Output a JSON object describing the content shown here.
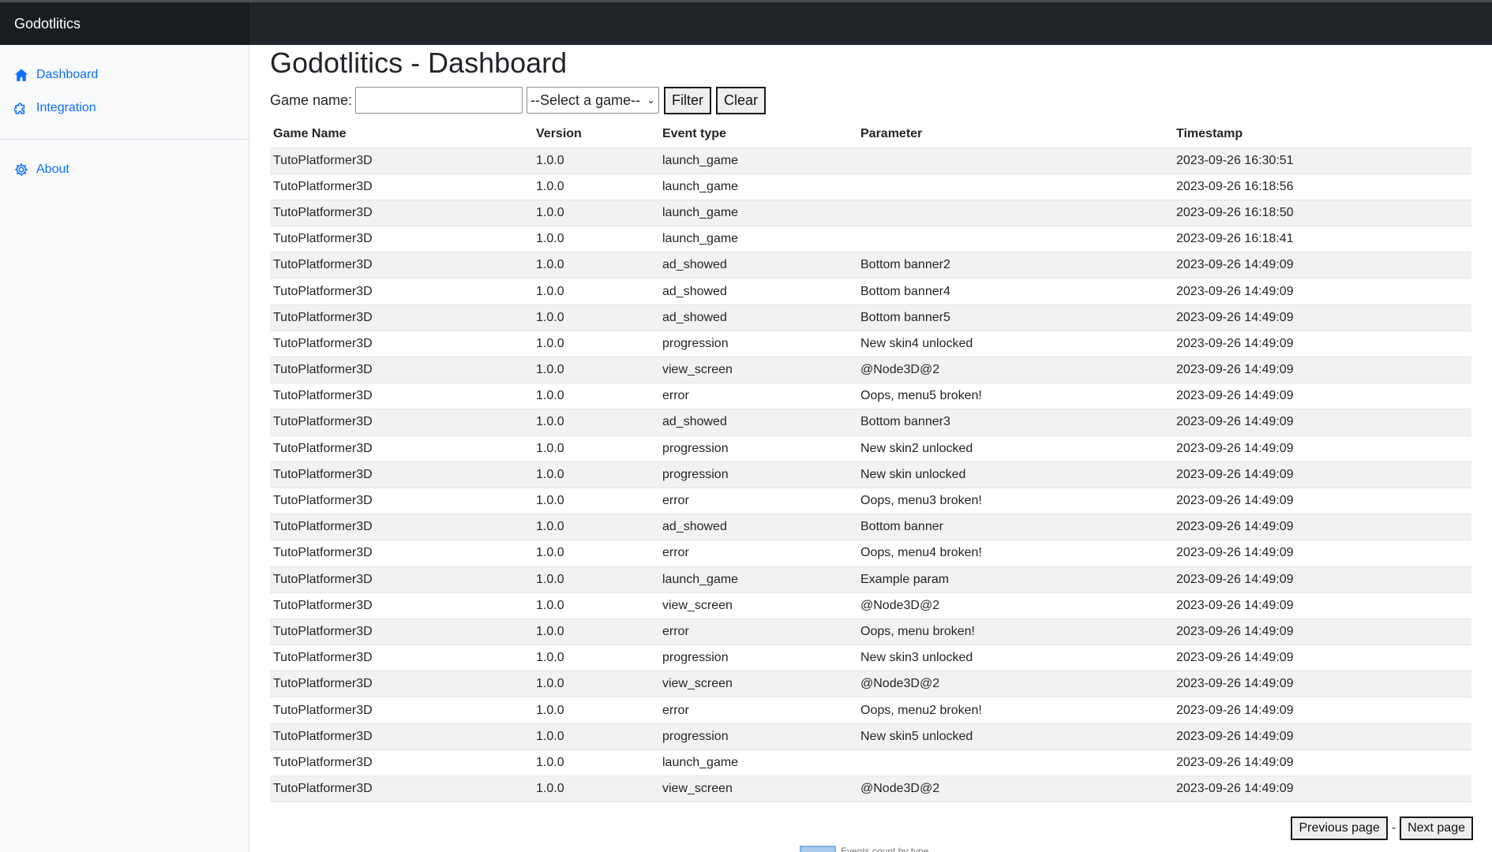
{
  "app": {
    "brand": "Godotlitics"
  },
  "sidebar": {
    "items": [
      {
        "label": "Dashboard",
        "icon": "home-icon"
      },
      {
        "label": "Integration",
        "icon": "puzzle-icon"
      },
      {
        "label": "About",
        "icon": "gear-icon"
      }
    ]
  },
  "page": {
    "title": "Godotlitics - Dashboard"
  },
  "filter": {
    "label": "Game name:",
    "input_value": "",
    "select_value": "--Select a game--",
    "filter_label": "Filter",
    "clear_label": "Clear"
  },
  "table": {
    "headers": [
      "Game Name",
      "Version",
      "Event type",
      "Parameter",
      "Timestamp"
    ],
    "rows": [
      [
        "TutoPlatformer3D",
        "1.0.0",
        "launch_game",
        "",
        "2023-09-26 16:30:51"
      ],
      [
        "TutoPlatformer3D",
        "1.0.0",
        "launch_game",
        "",
        "2023-09-26 16:18:56"
      ],
      [
        "TutoPlatformer3D",
        "1.0.0",
        "launch_game",
        "",
        "2023-09-26 16:18:50"
      ],
      [
        "TutoPlatformer3D",
        "1.0.0",
        "launch_game",
        "",
        "2023-09-26 16:18:41"
      ],
      [
        "TutoPlatformer3D",
        "1.0.0",
        "ad_showed",
        "Bottom banner2",
        "2023-09-26 14:49:09"
      ],
      [
        "TutoPlatformer3D",
        "1.0.0",
        "ad_showed",
        "Bottom banner4",
        "2023-09-26 14:49:09"
      ],
      [
        "TutoPlatformer3D",
        "1.0.0",
        "ad_showed",
        "Bottom banner5",
        "2023-09-26 14:49:09"
      ],
      [
        "TutoPlatformer3D",
        "1.0.0",
        "progression",
        "New skin4 unlocked",
        "2023-09-26 14:49:09"
      ],
      [
        "TutoPlatformer3D",
        "1.0.0",
        "view_screen",
        "@Node3D@2",
        "2023-09-26 14:49:09"
      ],
      [
        "TutoPlatformer3D",
        "1.0.0",
        "error",
        "Oops, menu5 broken!",
        "2023-09-26 14:49:09"
      ],
      [
        "TutoPlatformer3D",
        "1.0.0",
        "ad_showed",
        "Bottom banner3",
        "2023-09-26 14:49:09"
      ],
      [
        "TutoPlatformer3D",
        "1.0.0",
        "progression",
        "New skin2 unlocked",
        "2023-09-26 14:49:09"
      ],
      [
        "TutoPlatformer3D",
        "1.0.0",
        "progression",
        "New skin unlocked",
        "2023-09-26 14:49:09"
      ],
      [
        "TutoPlatformer3D",
        "1.0.0",
        "error",
        "Oops, menu3 broken!",
        "2023-09-26 14:49:09"
      ],
      [
        "TutoPlatformer3D",
        "1.0.0",
        "ad_showed",
        "Bottom banner",
        "2023-09-26 14:49:09"
      ],
      [
        "TutoPlatformer3D",
        "1.0.0",
        "error",
        "Oops, menu4 broken!",
        "2023-09-26 14:49:09"
      ],
      [
        "TutoPlatformer3D",
        "1.0.0",
        "launch_game",
        "Example param",
        "2023-09-26 14:49:09"
      ],
      [
        "TutoPlatformer3D",
        "1.0.0",
        "view_screen",
        "@Node3D@2",
        "2023-09-26 14:49:09"
      ],
      [
        "TutoPlatformer3D",
        "1.0.0",
        "error",
        "Oops, menu broken!",
        "2023-09-26 14:49:09"
      ],
      [
        "TutoPlatformer3D",
        "1.0.0",
        "progression",
        "New skin3 unlocked",
        "2023-09-26 14:49:09"
      ],
      [
        "TutoPlatformer3D",
        "1.0.0",
        "view_screen",
        "@Node3D@2",
        "2023-09-26 14:49:09"
      ],
      [
        "TutoPlatformer3D",
        "1.0.0",
        "error",
        "Oops, menu2 broken!",
        "2023-09-26 14:49:09"
      ],
      [
        "TutoPlatformer3D",
        "1.0.0",
        "progression",
        "New skin5 unlocked",
        "2023-09-26 14:49:09"
      ],
      [
        "TutoPlatformer3D",
        "1.0.0",
        "launch_game",
        "",
        "2023-09-26 14:49:09"
      ],
      [
        "TutoPlatformer3D",
        "1.0.0",
        "view_screen",
        "@Node3D@2",
        "2023-09-26 14:49:09"
      ]
    ]
  },
  "pagination": {
    "previous_label": "Previous page",
    "separator": "-",
    "next_label": "Next page"
  },
  "chart_legend": {
    "label": "Events count by type"
  },
  "colors": {
    "topbar": "#212529",
    "link": "#0d6efd",
    "stripe": "#f2f2f2",
    "legend_swatch": "#a9cbee"
  }
}
